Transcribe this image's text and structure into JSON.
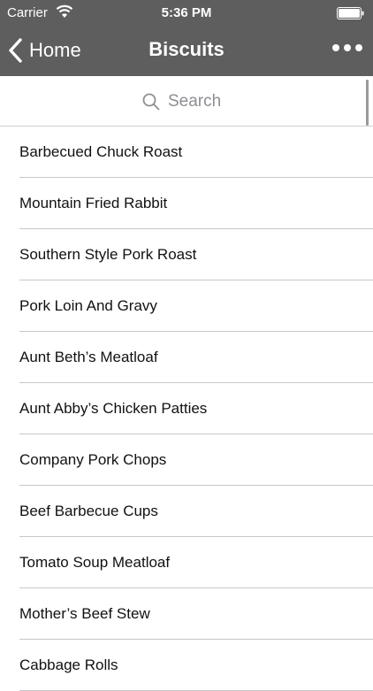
{
  "status_bar": {
    "carrier": "Carrier",
    "time": "5:36 PM",
    "wifi_icon": "wifi-icon",
    "battery_icon": "battery-icon"
  },
  "nav": {
    "back_label": "Home",
    "title": "Biscuits",
    "more_icon": "more-dots-icon"
  },
  "search": {
    "placeholder": "Search"
  },
  "recipes": [
    "Barbecued Chuck Roast",
    "Mountain Fried Rabbit",
    "Southern Style Pork Roast",
    "Pork Loin And Gravy",
    "Aunt Beth’s Meatloaf",
    "Aunt Abby’s Chicken Patties",
    "Company Pork Chops",
    "Beef Barbecue Cups",
    "Tomato Soup Meatloaf",
    "Mother’s Beef Stew",
    "Cabbage Rolls"
  ],
  "colors": {
    "header_bg": "#5e5e5e",
    "separator": "#c8c7cc",
    "placeholder": "#8e8e93"
  }
}
